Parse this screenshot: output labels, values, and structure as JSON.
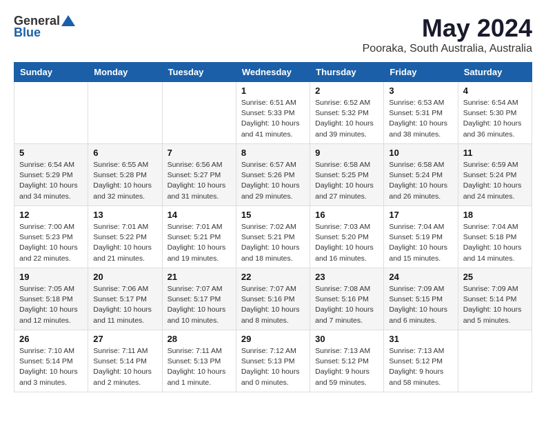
{
  "logo": {
    "general": "General",
    "blue": "Blue"
  },
  "title": "May 2024",
  "location": "Pooraka, South Australia, Australia",
  "days_of_week": [
    "Sunday",
    "Monday",
    "Tuesday",
    "Wednesday",
    "Thursday",
    "Friday",
    "Saturday"
  ],
  "weeks": [
    [
      {
        "day": "",
        "info": ""
      },
      {
        "day": "",
        "info": ""
      },
      {
        "day": "",
        "info": ""
      },
      {
        "day": "1",
        "info": "Sunrise: 6:51 AM\nSunset: 5:33 PM\nDaylight: 10 hours\nand 41 minutes."
      },
      {
        "day": "2",
        "info": "Sunrise: 6:52 AM\nSunset: 5:32 PM\nDaylight: 10 hours\nand 39 minutes."
      },
      {
        "day": "3",
        "info": "Sunrise: 6:53 AM\nSunset: 5:31 PM\nDaylight: 10 hours\nand 38 minutes."
      },
      {
        "day": "4",
        "info": "Sunrise: 6:54 AM\nSunset: 5:30 PM\nDaylight: 10 hours\nand 36 minutes."
      }
    ],
    [
      {
        "day": "5",
        "info": "Sunrise: 6:54 AM\nSunset: 5:29 PM\nDaylight: 10 hours\nand 34 minutes."
      },
      {
        "day": "6",
        "info": "Sunrise: 6:55 AM\nSunset: 5:28 PM\nDaylight: 10 hours\nand 32 minutes."
      },
      {
        "day": "7",
        "info": "Sunrise: 6:56 AM\nSunset: 5:27 PM\nDaylight: 10 hours\nand 31 minutes."
      },
      {
        "day": "8",
        "info": "Sunrise: 6:57 AM\nSunset: 5:26 PM\nDaylight: 10 hours\nand 29 minutes."
      },
      {
        "day": "9",
        "info": "Sunrise: 6:58 AM\nSunset: 5:25 PM\nDaylight: 10 hours\nand 27 minutes."
      },
      {
        "day": "10",
        "info": "Sunrise: 6:58 AM\nSunset: 5:24 PM\nDaylight: 10 hours\nand 26 minutes."
      },
      {
        "day": "11",
        "info": "Sunrise: 6:59 AM\nSunset: 5:24 PM\nDaylight: 10 hours\nand 24 minutes."
      }
    ],
    [
      {
        "day": "12",
        "info": "Sunrise: 7:00 AM\nSunset: 5:23 PM\nDaylight: 10 hours\nand 22 minutes."
      },
      {
        "day": "13",
        "info": "Sunrise: 7:01 AM\nSunset: 5:22 PM\nDaylight: 10 hours\nand 21 minutes."
      },
      {
        "day": "14",
        "info": "Sunrise: 7:01 AM\nSunset: 5:21 PM\nDaylight: 10 hours\nand 19 minutes."
      },
      {
        "day": "15",
        "info": "Sunrise: 7:02 AM\nSunset: 5:21 PM\nDaylight: 10 hours\nand 18 minutes."
      },
      {
        "day": "16",
        "info": "Sunrise: 7:03 AM\nSunset: 5:20 PM\nDaylight: 10 hours\nand 16 minutes."
      },
      {
        "day": "17",
        "info": "Sunrise: 7:04 AM\nSunset: 5:19 PM\nDaylight: 10 hours\nand 15 minutes."
      },
      {
        "day": "18",
        "info": "Sunrise: 7:04 AM\nSunset: 5:18 PM\nDaylight: 10 hours\nand 14 minutes."
      }
    ],
    [
      {
        "day": "19",
        "info": "Sunrise: 7:05 AM\nSunset: 5:18 PM\nDaylight: 10 hours\nand 12 minutes."
      },
      {
        "day": "20",
        "info": "Sunrise: 7:06 AM\nSunset: 5:17 PM\nDaylight: 10 hours\nand 11 minutes."
      },
      {
        "day": "21",
        "info": "Sunrise: 7:07 AM\nSunset: 5:17 PM\nDaylight: 10 hours\nand 10 minutes."
      },
      {
        "day": "22",
        "info": "Sunrise: 7:07 AM\nSunset: 5:16 PM\nDaylight: 10 hours\nand 8 minutes."
      },
      {
        "day": "23",
        "info": "Sunrise: 7:08 AM\nSunset: 5:16 PM\nDaylight: 10 hours\nand 7 minutes."
      },
      {
        "day": "24",
        "info": "Sunrise: 7:09 AM\nSunset: 5:15 PM\nDaylight: 10 hours\nand 6 minutes."
      },
      {
        "day": "25",
        "info": "Sunrise: 7:09 AM\nSunset: 5:14 PM\nDaylight: 10 hours\nand 5 minutes."
      }
    ],
    [
      {
        "day": "26",
        "info": "Sunrise: 7:10 AM\nSunset: 5:14 PM\nDaylight: 10 hours\nand 3 minutes."
      },
      {
        "day": "27",
        "info": "Sunrise: 7:11 AM\nSunset: 5:14 PM\nDaylight: 10 hours\nand 2 minutes."
      },
      {
        "day": "28",
        "info": "Sunrise: 7:11 AM\nSunset: 5:13 PM\nDaylight: 10 hours\nand 1 minute."
      },
      {
        "day": "29",
        "info": "Sunrise: 7:12 AM\nSunset: 5:13 PM\nDaylight: 10 hours\nand 0 minutes."
      },
      {
        "day": "30",
        "info": "Sunrise: 7:13 AM\nSunset: 5:12 PM\nDaylight: 9 hours\nand 59 minutes."
      },
      {
        "day": "31",
        "info": "Sunrise: 7:13 AM\nSunset: 5:12 PM\nDaylight: 9 hours\nand 58 minutes."
      },
      {
        "day": "",
        "info": ""
      }
    ]
  ]
}
